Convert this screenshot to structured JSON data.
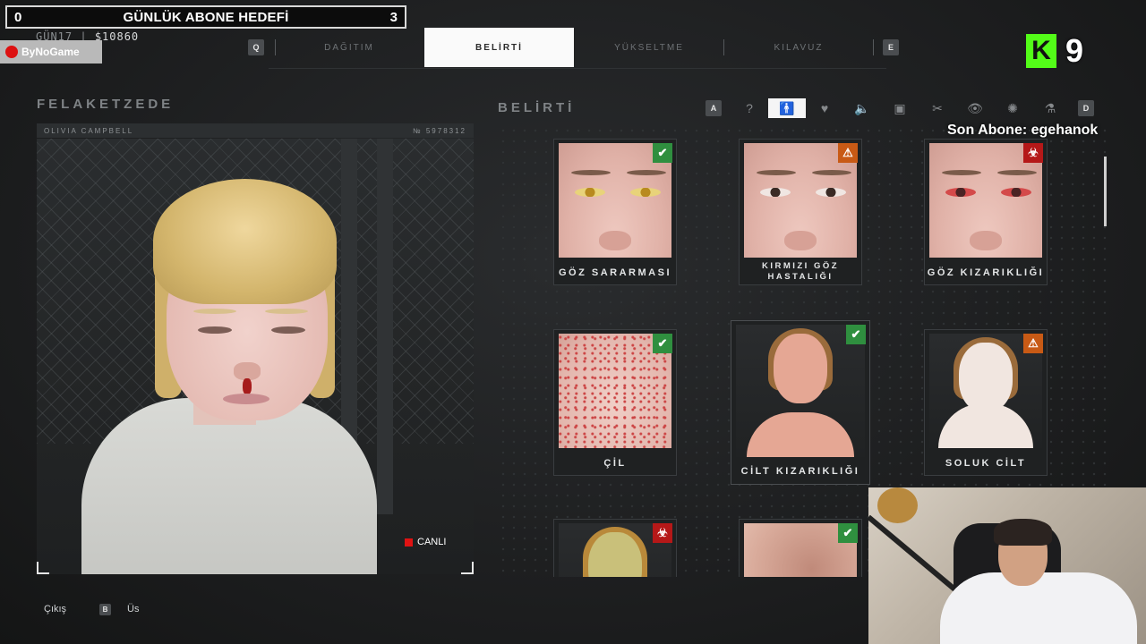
{
  "overlay": {
    "goal_left": "0",
    "goal_title": "GÜNLÜK ABONE HEDEFİ",
    "goal_right": "3",
    "day": "GÜN17 |",
    "money": "$10860",
    "logo_text": "ByNoGame",
    "kick_count": "9",
    "last_sub": "Son Abone: egehanok"
  },
  "tabs": {
    "key_left": "Q",
    "key_right": "E",
    "items": [
      {
        "label": "DAĞITIM"
      },
      {
        "label": "BELİRTİ"
      },
      {
        "label": "YÜKSELTME"
      },
      {
        "label": "KILAVUZ"
      }
    ],
    "active": "BELİRTİ"
  },
  "patient": {
    "heading": "FELAKETZEDE",
    "name": "OLIVIA CAMPBELL",
    "number": "№ 5978312",
    "live_label": "CANLI"
  },
  "symptoms": {
    "heading": "BELİRTİ",
    "filter_key_left": "A",
    "filter_key_right": "D",
    "filters": [
      {
        "icon": "question-icon",
        "glyph": "?"
      },
      {
        "icon": "body-icon",
        "glyph": "🚹"
      },
      {
        "icon": "heart-icon",
        "glyph": "♥"
      },
      {
        "icon": "sound-icon",
        "glyph": "🔈"
      },
      {
        "icon": "bag-icon",
        "glyph": "▣"
      },
      {
        "icon": "tools-icon",
        "glyph": "✂"
      },
      {
        "icon": "eye-icon",
        "glyph": "👁"
      },
      {
        "icon": "virus-icon",
        "glyph": "✺"
      },
      {
        "icon": "bottle-icon",
        "glyph": "⚗"
      }
    ],
    "active_filter": "body-icon",
    "cards": [
      {
        "label": "GÖZ SARARMASI",
        "badge": "ok",
        "iris": "#b88a1f",
        "sclera": "#e8d37a"
      },
      {
        "label": "KIRMIZI GÖZ\nHASTALIĞI",
        "badge": "warn",
        "iris": "#3a2a24",
        "sclera": "#f0e6e2"
      },
      {
        "label": "GÖZ KIZARIKLIĞI",
        "badge": "bio",
        "iris": "#4a2424",
        "sclera": "#d44a4a"
      },
      {
        "label": "ÇİL",
        "badge": "ok"
      },
      {
        "label": "CİLT KIZARIKLIĞI",
        "badge": "ok",
        "skin": "#e5a794"
      },
      {
        "label": "SOLUK CİLT",
        "badge": "warn",
        "skin": "#f1e6e0"
      },
      {
        "label": "",
        "badge": "bio",
        "skin": "#c9c07a"
      },
      {
        "label": "",
        "badge": "ok"
      }
    ],
    "badge_glyphs": {
      "ok": "✔",
      "warn": "⚠",
      "bio": "☣"
    }
  },
  "footer": {
    "exit_label": "Çıkış",
    "key_b": "B",
    "base_label": "Üs"
  }
}
